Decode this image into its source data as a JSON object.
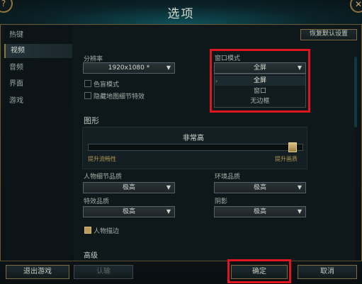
{
  "window": {
    "title": "选项",
    "help_icon": "?",
    "close_icon": "✕"
  },
  "sidebar": {
    "items": [
      {
        "label": "热键",
        "active": false
      },
      {
        "label": "视频",
        "active": true
      },
      {
        "label": "音频",
        "active": false
      },
      {
        "label": "界面",
        "active": false
      },
      {
        "label": "游戏",
        "active": false
      }
    ]
  },
  "content": {
    "reset_button": "恢复默认设置",
    "resolution": {
      "label": "分辨率",
      "value": "1920x1080 *"
    },
    "colorblind": {
      "label": "色盲模式",
      "checked": false
    },
    "hide_eye_candy": {
      "label": "隐藏地图细节特效",
      "checked": false
    },
    "window_mode": {
      "label": "窗口模式",
      "value": "全屏",
      "options": [
        "全屏",
        "窗口",
        "无边框"
      ],
      "selected_index": 0
    },
    "graphics": {
      "section_label": "图形",
      "level_label": "非常高",
      "level_fraction": 0.97,
      "left_hint": "提升流畅性",
      "right_hint": "提升画质"
    },
    "character_quality": {
      "label": "人物细节品质",
      "value": "极高"
    },
    "environment_quality": {
      "label": "环境品质",
      "value": "极高"
    },
    "effects_quality": {
      "label": "特效品质",
      "value": "极高"
    },
    "shadows": {
      "label": "阴影",
      "value": "极高"
    },
    "character_inking": {
      "label": "人物描边",
      "checked": true
    },
    "next_section_partial": "高级"
  },
  "footer": {
    "exit_game": "退出游戏",
    "surrender": "认输",
    "ok": "确定",
    "cancel": "取消"
  },
  "colors": {
    "highlight_red": "#e0151f",
    "gold_border": "#7d6a3f"
  }
}
